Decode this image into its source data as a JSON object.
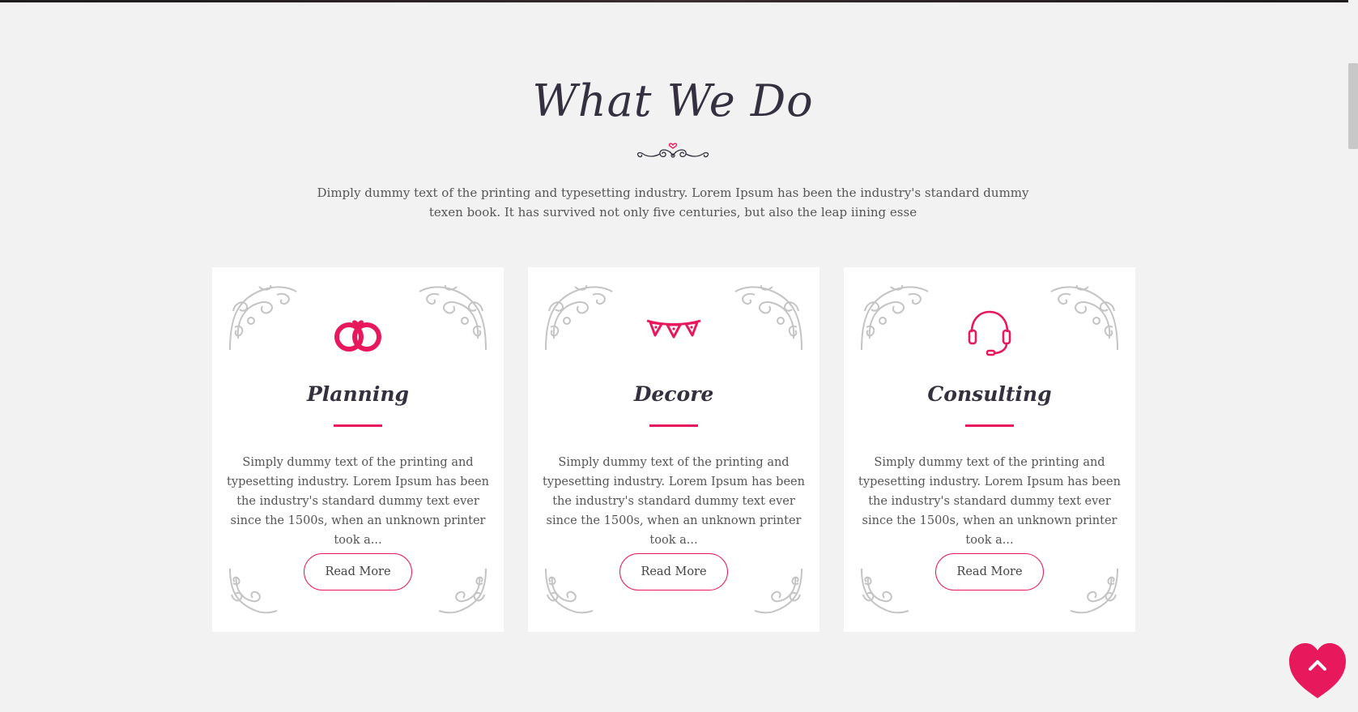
{
  "section": {
    "title": "What We Do",
    "intro": "Dimply dummy text of the printing and typesetting industry. Lorem Ipsum has been the industry's standard dummy texen book. It has survived not only five centuries, but also the leap iining esse"
  },
  "cards": [
    {
      "icon": "wedding-rings-icon",
      "title": "Planning",
      "text": "Simply dummy text of the printing and typesetting industry. Lorem Ipsum has been the industry's standard dummy text ever since the 1500s, when an unknown printer took a...",
      "button": "Read More"
    },
    {
      "icon": "bunting-flags-icon",
      "title": "Decore",
      "text": "Simply dummy text of the printing and typesetting industry. Lorem Ipsum has been the industry's standard dummy text ever since the 1500s, when an unknown printer took a...",
      "button": "Read More"
    },
    {
      "icon": "headset-icon",
      "title": "Consulting",
      "text": "Simply dummy text of the printing and typesetting industry. Lorem Ipsum has been the industry's standard dummy text ever since the 1500s, when an unknown printer took a...",
      "button": "Read More"
    }
  ],
  "back_to_top": {
    "icon": "heart-chevron-up-icon"
  },
  "colors": {
    "accent": "#e8185c",
    "heading": "#34303f",
    "body_text": "#555555",
    "background": "#f2f2f2",
    "card": "#ffffff",
    "ornament": "#c4c4c4"
  }
}
